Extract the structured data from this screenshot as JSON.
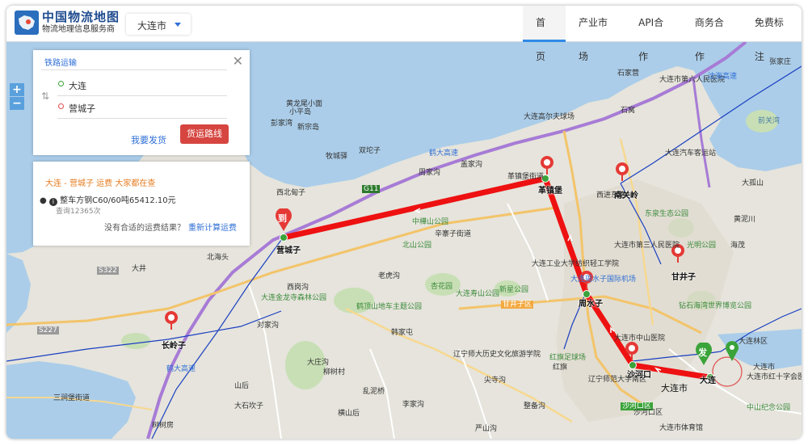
{
  "header": {
    "title": "中国物流地图",
    "subtitle": "物流地理信息服务商",
    "city_select": "大连市",
    "nav": [
      "首页",
      "产业市场",
      "API合作",
      "商务合作",
      "免费标注"
    ]
  },
  "zoom": {
    "in": "+",
    "out": "−"
  },
  "route_panel": {
    "tab": "铁路运输",
    "close": "✕",
    "from": "大连",
    "to": "营城子",
    "ship_link": "我要发货",
    "route_button": "货运路线"
  },
  "result_panel": {
    "heading": "大连 - 营城子 运费 大家都在查",
    "item": "整车方钢C60/60吨65412.10元",
    "queries": "查询12365次",
    "no_result": "没有合适的运费结果？",
    "recalc": "重新计算运费"
  },
  "markers": {
    "dest_badge": "到",
    "origin_badge": "发"
  },
  "stations": [
    {
      "name": "营城子"
    },
    {
      "name": "革镇堡"
    },
    {
      "name": "南关岭"
    },
    {
      "name": "甘井子"
    },
    {
      "name": "周水子"
    },
    {
      "name": "沙河口"
    },
    {
      "name": "大连"
    },
    {
      "name": "长岭子"
    }
  ],
  "map_labels": {
    "l01": "黄龙尾小面",
    "l02": "彭家湾",
    "l03": "新宗岛",
    "l04": "双坨子",
    "l05": "牧城驿",
    "l06": "鹤大高速",
    "l07": "西北甸子",
    "l08": "周家沟",
    "l09": "盖家沟",
    "l10": "革镇堡街道",
    "l11": "G11",
    "l12": "中樺山公园",
    "l13": "辛寨子街道",
    "l14": "北山公园",
    "l15": "北海头",
    "l16": "大井",
    "l17": "老虎沟",
    "l18": "杏花园",
    "l19": "大连寿山公园",
    "l20": "新星公园",
    "l21": "大连周水子国际机场",
    "l22": "甘井子区",
    "l23": "大连工业大学纺织轻工学院",
    "l24": "大连金龙寺森林公园",
    "l25": "西岗沟",
    "l26": "鹤顶山地车主题公园",
    "l27": "对家沟",
    "l28": "韩家屯",
    "l29": "辽宁师大历史文化旅游学院",
    "l30": "红旗足球场",
    "l31": "辽宁师范大学南区",
    "l32": "大连市",
    "l33": "沙河口区",
    "l34": "三涧堡街道",
    "l35": "大庄沟",
    "l36": "柳树村",
    "l37": "山后",
    "l38": "大石坎子",
    "l39": "乱泥桥",
    "l40": "李家沟",
    "l41": "横山后",
    "l42": "尖寺沟",
    "l43": "整备沟",
    "l44": "严山沟",
    "l45": "树树房",
    "l46": "大连市第六人民医院",
    "l47": "大连高尔夫球场",
    "l48": "石家营",
    "l49": "大连汽车客运站",
    "l50": "光明公园",
    "l51": "海茂",
    "l52": "大连市第三人民医院",
    "l53": "东泉生态公园",
    "l54": "西进东路",
    "l55": "大连市中山医院",
    "l56": "大连市红十字会医院",
    "l57": "大连市体育馆",
    "l58": "中山纪念公园",
    "l59": "张家庄",
    "l60": "沈海高速",
    "l61": "前关湾",
    "l62": "钻石海湾世界博览公园",
    "l63": "红旗",
    "l64": "大连市",
    "l65": "S227",
    "l66": "S322",
    "l67": "小平岛",
    "l68": "大孤山",
    "l69": "石窝",
    "l70": "鹤大高速",
    "l71": "黄泥川",
    "l72": "大连林区",
    "l73": "沙河口区"
  },
  "colors": {
    "route": "#ee1111",
    "accent": "#2f8ae6",
    "button": "#d64540",
    "orange": "#e67d22"
  }
}
